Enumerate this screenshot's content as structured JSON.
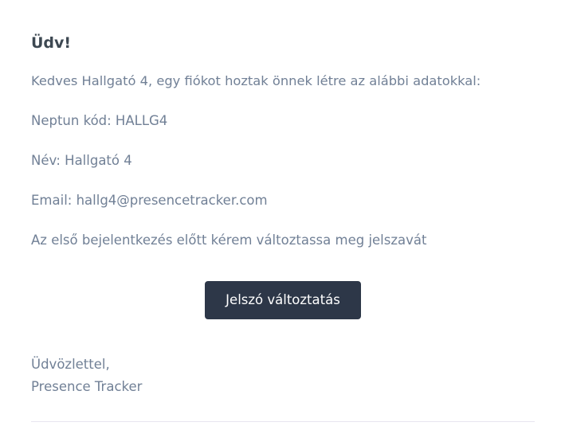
{
  "email": {
    "greeting": "Üdv!",
    "intro": "Kedves Hallgató 4, egy fiókot hoztak önnek létre az alábbi adatokkal:",
    "neptun": "Neptun kód: HALLG4",
    "name": "Név: Hallgató 4",
    "email_line": "Email: hallg4@presencetracker.com",
    "notice": "Az első bejelentkezés előtt kérem változtassa meg jelszavát",
    "button_label": "Jelszó változtatás",
    "salutation": "Üdvözlettel,",
    "signature": "Presence Tracker"
  },
  "colors": {
    "heading": "#3d4852",
    "body_text": "#718096",
    "button_bg": "#2d3748",
    "button_text": "#ffffff",
    "divider": "#e8e5ef"
  }
}
